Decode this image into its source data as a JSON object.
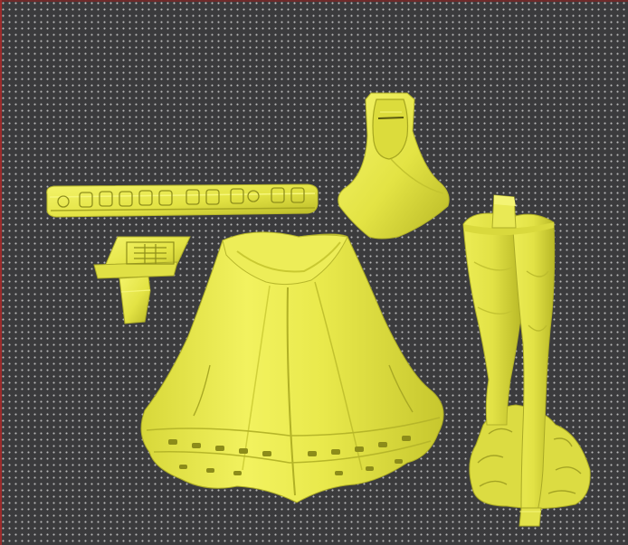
{
  "viewport": {
    "background": "#3b3b3d",
    "grid_color": "#e1e1e1",
    "model_color": "#e8e84a",
    "model_shadow": "#9d9d1d"
  },
  "objects": [
    {
      "name": "belt",
      "icon": "belt-part"
    },
    {
      "name": "clasp",
      "icon": "clasp-part"
    },
    {
      "name": "hood",
      "icon": "hood-part"
    },
    {
      "name": "cape",
      "icon": "cape-part"
    },
    {
      "name": "legs",
      "icon": "legs-part"
    }
  ]
}
